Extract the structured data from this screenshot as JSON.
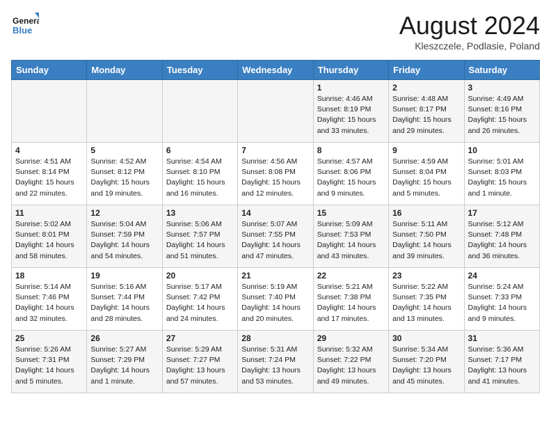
{
  "header": {
    "logo_line1": "General",
    "logo_line2": "Blue",
    "month_title": "August 2024",
    "subtitle": "Kleszczele, Podlasie, Poland"
  },
  "weekdays": [
    "Sunday",
    "Monday",
    "Tuesday",
    "Wednesday",
    "Thursday",
    "Friday",
    "Saturday"
  ],
  "weeks": [
    [
      {
        "day": "",
        "info": ""
      },
      {
        "day": "",
        "info": ""
      },
      {
        "day": "",
        "info": ""
      },
      {
        "day": "",
        "info": ""
      },
      {
        "day": "1",
        "info": "Sunrise: 4:46 AM\nSunset: 8:19 PM\nDaylight: 15 hours\nand 33 minutes."
      },
      {
        "day": "2",
        "info": "Sunrise: 4:48 AM\nSunset: 8:17 PM\nDaylight: 15 hours\nand 29 minutes."
      },
      {
        "day": "3",
        "info": "Sunrise: 4:49 AM\nSunset: 8:16 PM\nDaylight: 15 hours\nand 26 minutes."
      }
    ],
    [
      {
        "day": "4",
        "info": "Sunrise: 4:51 AM\nSunset: 8:14 PM\nDaylight: 15 hours\nand 22 minutes."
      },
      {
        "day": "5",
        "info": "Sunrise: 4:52 AM\nSunset: 8:12 PM\nDaylight: 15 hours\nand 19 minutes."
      },
      {
        "day": "6",
        "info": "Sunrise: 4:54 AM\nSunset: 8:10 PM\nDaylight: 15 hours\nand 16 minutes."
      },
      {
        "day": "7",
        "info": "Sunrise: 4:56 AM\nSunset: 8:08 PM\nDaylight: 15 hours\nand 12 minutes."
      },
      {
        "day": "8",
        "info": "Sunrise: 4:57 AM\nSunset: 8:06 PM\nDaylight: 15 hours\nand 9 minutes."
      },
      {
        "day": "9",
        "info": "Sunrise: 4:59 AM\nSunset: 8:04 PM\nDaylight: 15 hours\nand 5 minutes."
      },
      {
        "day": "10",
        "info": "Sunrise: 5:01 AM\nSunset: 8:03 PM\nDaylight: 15 hours\nand 1 minute."
      }
    ],
    [
      {
        "day": "11",
        "info": "Sunrise: 5:02 AM\nSunset: 8:01 PM\nDaylight: 14 hours\nand 58 minutes."
      },
      {
        "day": "12",
        "info": "Sunrise: 5:04 AM\nSunset: 7:59 PM\nDaylight: 14 hours\nand 54 minutes."
      },
      {
        "day": "13",
        "info": "Sunrise: 5:06 AM\nSunset: 7:57 PM\nDaylight: 14 hours\nand 51 minutes."
      },
      {
        "day": "14",
        "info": "Sunrise: 5:07 AM\nSunset: 7:55 PM\nDaylight: 14 hours\nand 47 minutes."
      },
      {
        "day": "15",
        "info": "Sunrise: 5:09 AM\nSunset: 7:53 PM\nDaylight: 14 hours\nand 43 minutes."
      },
      {
        "day": "16",
        "info": "Sunrise: 5:11 AM\nSunset: 7:50 PM\nDaylight: 14 hours\nand 39 minutes."
      },
      {
        "day": "17",
        "info": "Sunrise: 5:12 AM\nSunset: 7:48 PM\nDaylight: 14 hours\nand 36 minutes."
      }
    ],
    [
      {
        "day": "18",
        "info": "Sunrise: 5:14 AM\nSunset: 7:46 PM\nDaylight: 14 hours\nand 32 minutes."
      },
      {
        "day": "19",
        "info": "Sunrise: 5:16 AM\nSunset: 7:44 PM\nDaylight: 14 hours\nand 28 minutes."
      },
      {
        "day": "20",
        "info": "Sunrise: 5:17 AM\nSunset: 7:42 PM\nDaylight: 14 hours\nand 24 minutes."
      },
      {
        "day": "21",
        "info": "Sunrise: 5:19 AM\nSunset: 7:40 PM\nDaylight: 14 hours\nand 20 minutes."
      },
      {
        "day": "22",
        "info": "Sunrise: 5:21 AM\nSunset: 7:38 PM\nDaylight: 14 hours\nand 17 minutes."
      },
      {
        "day": "23",
        "info": "Sunrise: 5:22 AM\nSunset: 7:35 PM\nDaylight: 14 hours\nand 13 minutes."
      },
      {
        "day": "24",
        "info": "Sunrise: 5:24 AM\nSunset: 7:33 PM\nDaylight: 14 hours\nand 9 minutes."
      }
    ],
    [
      {
        "day": "25",
        "info": "Sunrise: 5:26 AM\nSunset: 7:31 PM\nDaylight: 14 hours\nand 5 minutes."
      },
      {
        "day": "26",
        "info": "Sunrise: 5:27 AM\nSunset: 7:29 PM\nDaylight: 14 hours\nand 1 minute."
      },
      {
        "day": "27",
        "info": "Sunrise: 5:29 AM\nSunset: 7:27 PM\nDaylight: 13 hours\nand 57 minutes."
      },
      {
        "day": "28",
        "info": "Sunrise: 5:31 AM\nSunset: 7:24 PM\nDaylight: 13 hours\nand 53 minutes."
      },
      {
        "day": "29",
        "info": "Sunrise: 5:32 AM\nSunset: 7:22 PM\nDaylight: 13 hours\nand 49 minutes."
      },
      {
        "day": "30",
        "info": "Sunrise: 5:34 AM\nSunset: 7:20 PM\nDaylight: 13 hours\nand 45 minutes."
      },
      {
        "day": "31",
        "info": "Sunrise: 5:36 AM\nSunset: 7:17 PM\nDaylight: 13 hours\nand 41 minutes."
      }
    ]
  ]
}
